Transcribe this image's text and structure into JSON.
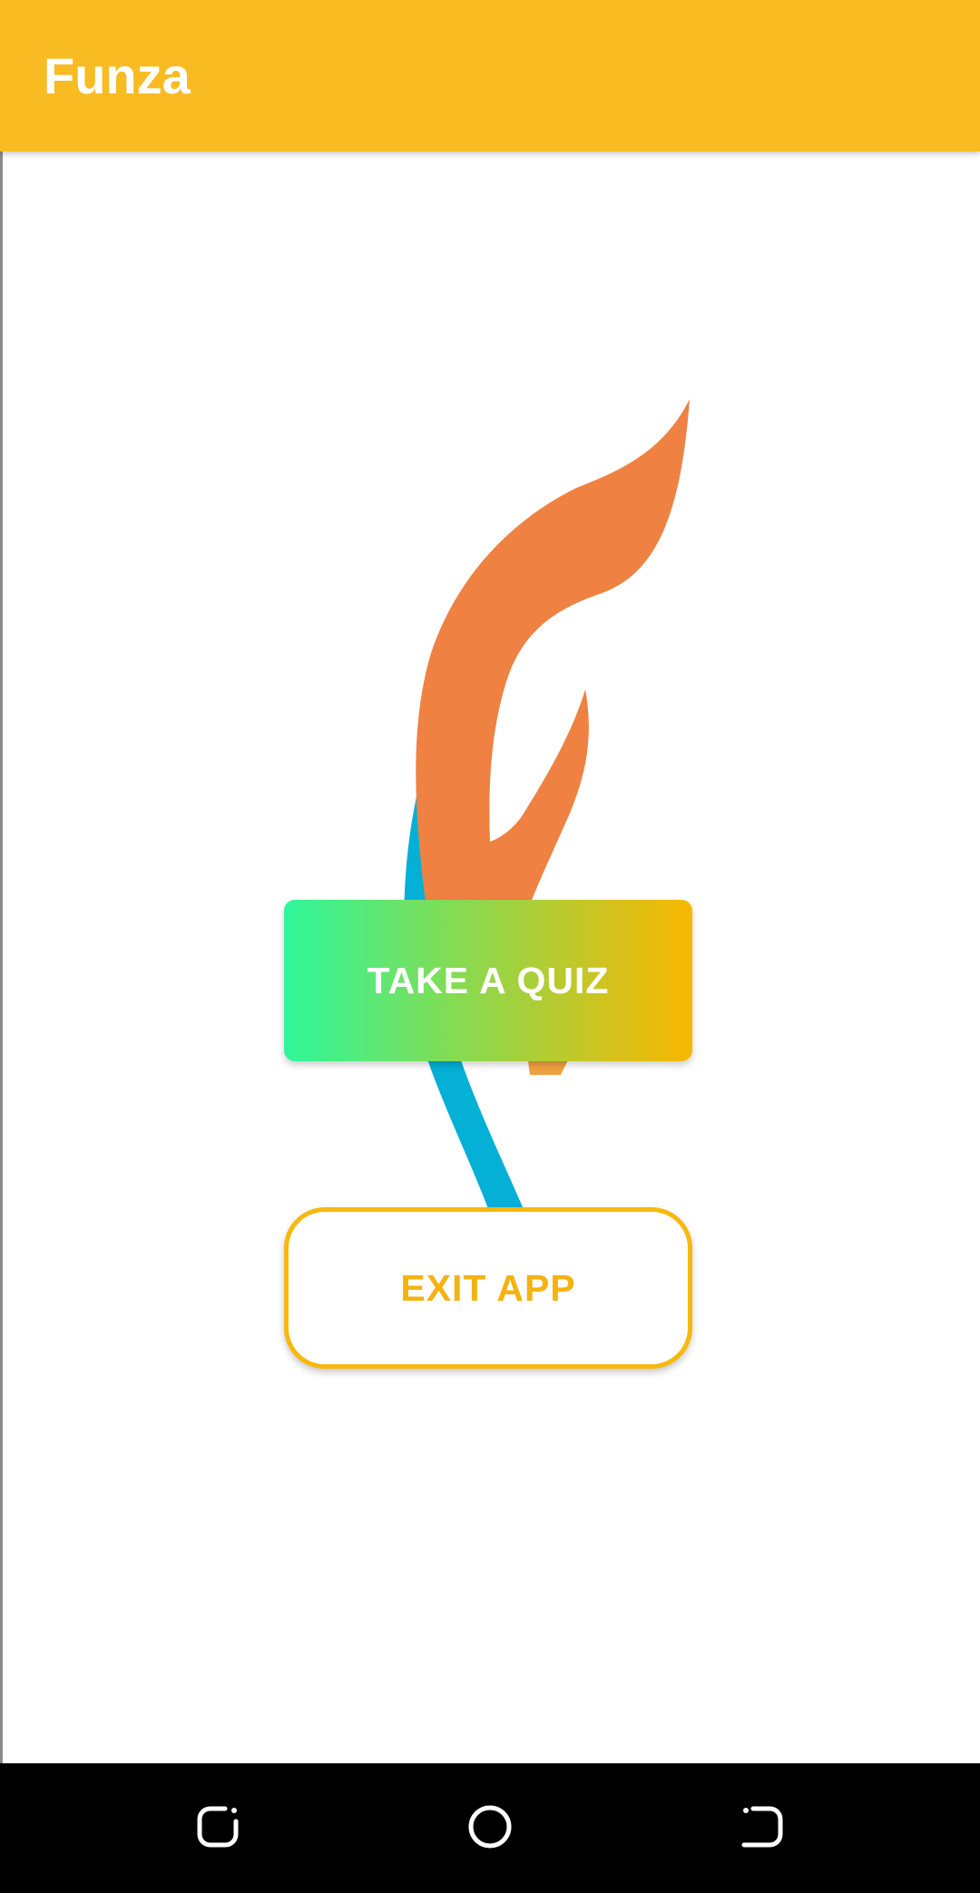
{
  "app_bar": {
    "title": "Funza",
    "color": "#F8BC22"
  },
  "main": {
    "logo_icon": "flame-logo-icon",
    "buttons": {
      "take_quiz_label": "TAKE A QUIZ",
      "exit_app_label": "EXIT APP"
    },
    "colors": {
      "quiz_gradient_start": "#2EF69A",
      "quiz_gradient_end": "#F9B800",
      "exit_border": "#F7B80F",
      "flame_orange": "#EF8142",
      "flame_blue": "#05B0D7",
      "flame_light_orange": "#F0A13F"
    }
  },
  "nav_bar": {
    "icons": [
      "recent-apps-icon",
      "home-icon",
      "back-icon"
    ]
  }
}
